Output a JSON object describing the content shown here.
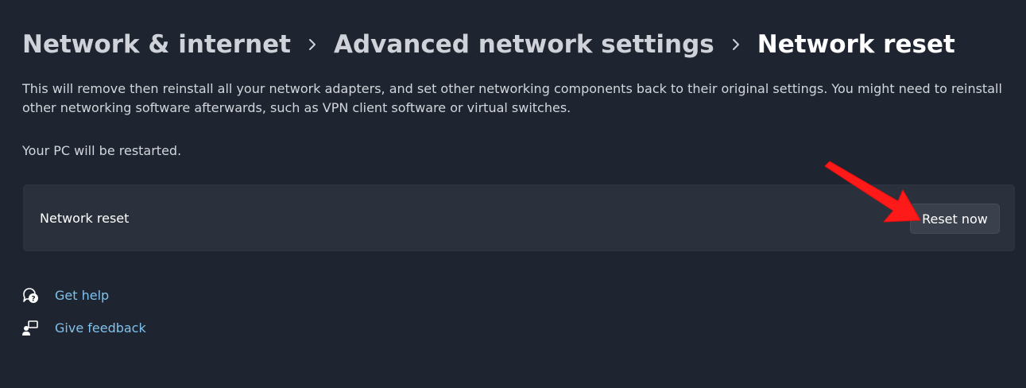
{
  "breadcrumb": {
    "items": [
      {
        "label": "Network & internet"
      },
      {
        "label": "Advanced network settings"
      },
      {
        "label": "Network reset"
      }
    ]
  },
  "description": "This will remove then reinstall all your network adapters, and set other networking components back to their original settings. You might need to reinstall other networking software afterwards, such as VPN client software or virtual switches.",
  "restart_note": "Your PC will be restarted.",
  "reset_card": {
    "label": "Network reset",
    "button_label": "Reset now"
  },
  "links": {
    "get_help": "Get help",
    "give_feedback": "Give feedback"
  },
  "icons": {
    "separator": "chevron-right-icon",
    "help": "help-chat-icon",
    "feedback": "feedback-person-icon"
  },
  "colors": {
    "background": "#1f2530",
    "card": "#2b313c",
    "button": "#3b414c",
    "link": "#7ec2ef",
    "annotation_arrow": "#ff1a1a"
  }
}
